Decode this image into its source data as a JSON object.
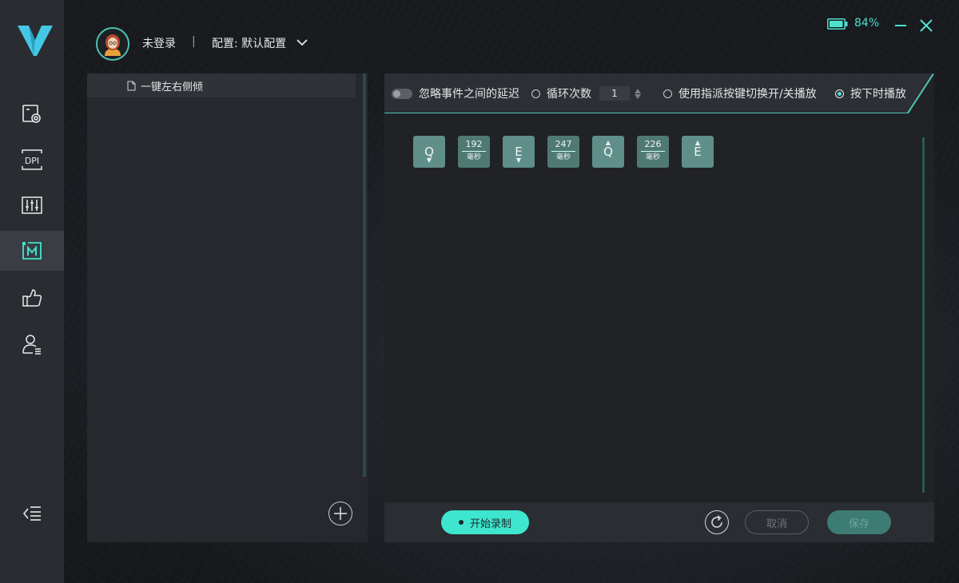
{
  "header": {
    "login_status": "未登录",
    "separator": "|",
    "config_label": "配置: 默认配置",
    "battery": "84%"
  },
  "nav": {
    "items": [
      {
        "name": "device-settings-icon"
      },
      {
        "name": "dpi-icon",
        "label": "DPI"
      },
      {
        "name": "equalizer-icon"
      },
      {
        "name": "macro-icon",
        "active": true
      },
      {
        "name": "thumbs-up-icon"
      },
      {
        "name": "user-list-icon"
      }
    ],
    "collapse_icon": "collapse-menu-icon"
  },
  "macro_list": {
    "items": [
      {
        "label": "一键左右侧倾"
      }
    ]
  },
  "toolbar": {
    "ignore_delay_label": "忽略事件之间的延迟",
    "loop_count_label": "循环次数",
    "loop_count_value": "1",
    "toggle_mode_label": "使用指派按键切换开/关播放",
    "hold_mode_label": "按下时播放",
    "selected_mode": "hold"
  },
  "events": [
    {
      "type": "key",
      "key": "Q",
      "direction": "down"
    },
    {
      "type": "delay",
      "value": "192",
      "unit": "毫秒"
    },
    {
      "type": "key",
      "key": "E",
      "direction": "down"
    },
    {
      "type": "delay",
      "value": "247",
      "unit": "毫秒"
    },
    {
      "type": "key",
      "key": "Q",
      "direction": "up"
    },
    {
      "type": "delay",
      "value": "226",
      "unit": "毫秒"
    },
    {
      "type": "key",
      "key": "E",
      "direction": "up"
    }
  ],
  "bottom": {
    "record_label": "开始录制",
    "cancel_label": "取消",
    "save_label": "保存"
  },
  "colors": {
    "accent": "#4ee0cd",
    "key_bg": "#5f8f88",
    "delay_bg": "#4f7a74"
  }
}
